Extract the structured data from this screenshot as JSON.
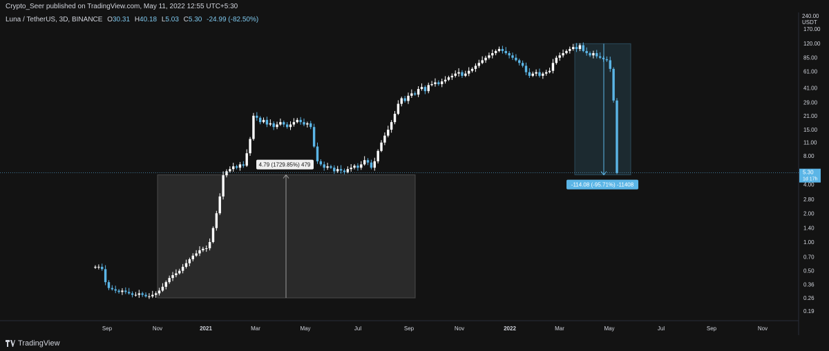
{
  "header": {
    "publisher_text": "Crypto_Seer published on TradingView.com, May 11, 2022 12:55 UTC+5:30"
  },
  "symbol": {
    "name": "Luna / TetherUS, 3D, BINANCE",
    "open_label": "O",
    "open": "30.31",
    "high_label": "H",
    "high": "40.18",
    "low_label": "L",
    "low": "5.03",
    "close_label": "C",
    "close": "5.30",
    "change": "-24.99 (-82.50%)"
  },
  "price_axis": {
    "currency": "USDT",
    "top_label": "240.00",
    "current_price": "5.30",
    "countdown": "1d 17h"
  },
  "footer": {
    "brand": "TradingView"
  },
  "colors": {
    "background": "#131313",
    "up": "#ffffff",
    "down": "#5bb5e6",
    "measure_fill_up": "#2a2a2a",
    "measure_fill_down": "#1c2a30",
    "accent": "#5bb5e6"
  },
  "chart_data": {
    "type": "candlestick",
    "title": "",
    "ylabel": "",
    "xlabel": "",
    "y_scale": "log",
    "ylim": [
      0.15,
      240
    ],
    "x_tick_labels": [
      "Sep",
      "Nov",
      "2021",
      "Mar",
      "May",
      "Jul",
      "Sep",
      "Nov",
      "2022",
      "Mar",
      "May",
      "Jul",
      "Sep",
      "Nov"
    ],
    "y_tick_labels": [
      "170.00",
      "120.00",
      "85.00",
      "61.00",
      "41.00",
      "29.00",
      "21.00",
      "15.00",
      "11.00",
      "8.00",
      "5.30",
      "4.00",
      "2.80",
      "2.00",
      "1.40",
      "1.00",
      "0.70",
      "0.50",
      "0.36",
      "0.26",
      "0.19"
    ],
    "y_tick_values": [
      170,
      120,
      85,
      61,
      41,
      29,
      21,
      15,
      11,
      8,
      5.3,
      4,
      2.8,
      2,
      1.4,
      1,
      0.7,
      0.5,
      0.36,
      0.26,
      0.19
    ],
    "close_path": [
      0.55,
      0.55,
      0.52,
      0.38,
      0.33,
      0.32,
      0.31,
      0.3,
      0.31,
      0.3,
      0.29,
      0.28,
      0.28,
      0.29,
      0.28,
      0.27,
      0.27,
      0.28,
      0.29,
      0.31,
      0.34,
      0.38,
      0.42,
      0.45,
      0.47,
      0.5,
      0.55,
      0.6,
      0.66,
      0.72,
      0.76,
      0.82,
      0.85,
      0.86,
      1.0,
      1.4,
      2.0,
      3.0,
      5.0,
      5.5,
      5.8,
      6.2,
      6.0,
      6.5,
      6.3,
      8.5,
      12,
      21,
      20,
      18,
      19,
      17,
      17.5,
      16,
      17,
      18,
      17,
      16,
      17,
      18,
      19,
      18,
      17,
      17.5,
      16,
      10,
      7,
      6.5,
      6,
      6.2,
      6,
      5.5,
      5.8,
      5.6,
      5.4,
      5.8,
      6,
      6.3,
      6,
      6.5,
      7.2,
      6.8,
      6,
      7,
      9,
      11,
      13,
      15,
      18,
      22,
      28,
      32,
      30,
      34,
      36,
      35,
      40,
      42,
      38,
      44,
      45,
      47,
      45,
      48,
      50,
      53,
      55,
      58,
      60,
      55,
      58,
      62,
      65,
      70,
      75,
      80,
      85,
      90,
      95,
      100,
      105,
      100,
      95,
      90,
      85,
      80,
      75,
      70,
      60,
      55,
      58,
      60,
      55,
      58,
      60,
      62,
      75,
      85,
      90,
      95,
      100,
      105,
      110,
      105,
      115,
      100,
      95,
      90,
      95,
      88,
      85,
      82,
      80,
      65,
      30.31,
      5.3
    ],
    "measurements": [
      {
        "label": "4.79 (1729.85%) 479",
        "from": 0.26,
        "to": 5.05
      },
      {
        "label": "-114.08 (-95.71%) -11408",
        "from": 119.3,
        "to": 5.05
      }
    ],
    "grid": false
  }
}
